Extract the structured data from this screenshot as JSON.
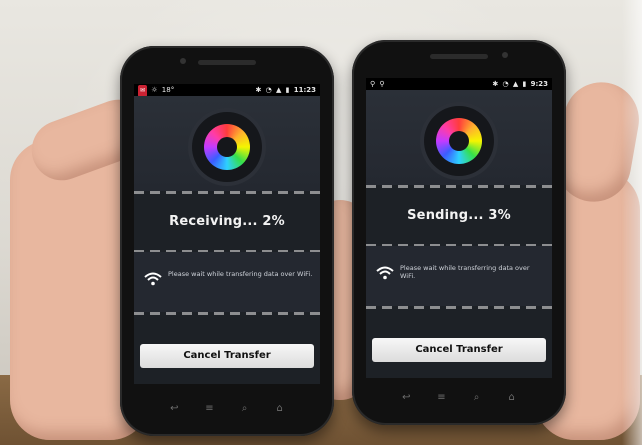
{
  "phones": [
    {
      "id": "left",
      "statusbar": {
        "mail_badge": "✉",
        "time": "11:23",
        "temp": "18°"
      },
      "status_text": "Receiving... 2%",
      "progress_percent": 2,
      "info_text": "Please wait while transfering data over WiFi.",
      "button_label": "Cancel Transfer",
      "nav_icons": [
        "back-icon",
        "menu-icon",
        "search-icon",
        "home-icon"
      ]
    },
    {
      "id": "right",
      "statusbar": {
        "time": "9:23"
      },
      "status_text": "Sending... 3%",
      "progress_percent": 3,
      "info_text": "Please wait while transferring data over WiFi.",
      "button_label": "Cancel Transfer",
      "nav_icons": [
        "back-icon",
        "menu-icon",
        "search-icon",
        "home-icon"
      ]
    }
  ],
  "colors": {
    "screen_bg": "#1d2126",
    "button_bg": "#e6e6e6",
    "text": "#f3f3f3"
  }
}
